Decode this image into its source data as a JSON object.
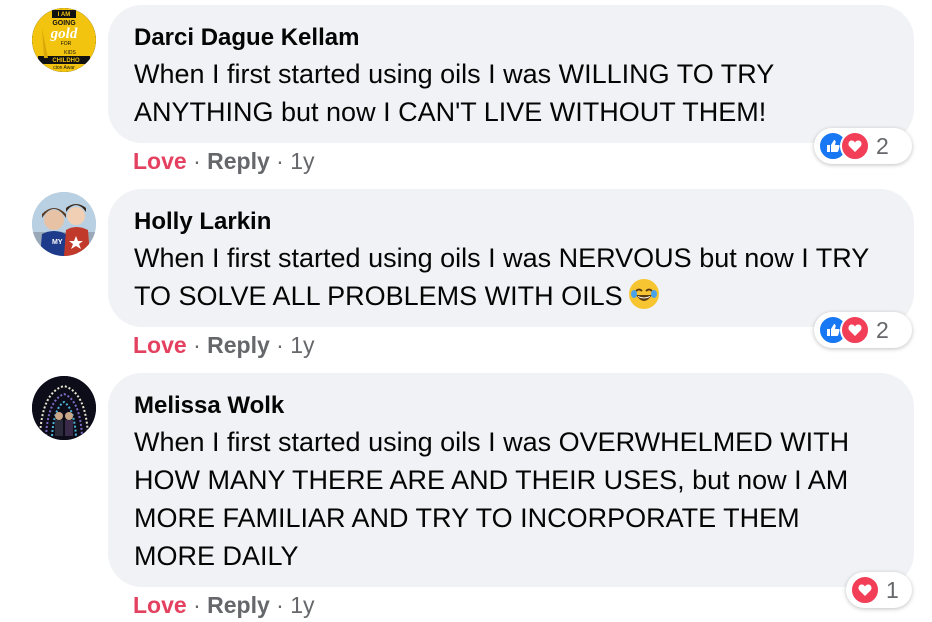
{
  "comments": [
    {
      "author": "Darci Dague Kellam",
      "text": "When I first started using oils I was WILLING TO TRY ANYTHING but now I CAN'T LIVE WITHOUT THEM!",
      "love": "Love",
      "sep1": "·",
      "reply": "Reply",
      "sep2": "·",
      "time": "1y",
      "reaction_count": "2",
      "reactions": [
        "like-icon",
        "love-icon"
      ],
      "avatar_text": [
        "I AM",
        "GOING",
        "gold",
        "FOR",
        "KIDS",
        "CHILDHO",
        "cion Awar"
      ]
    },
    {
      "author": "Holly Larkin",
      "text": "When I first started using oils I was NERVOUS but now I TRY TO SOLVE ALL PROBLEMS WITH OILS",
      "love": "Love",
      "sep1": "·",
      "reply": "Reply",
      "sep2": "·",
      "time": "1y",
      "reaction_count": "2",
      "reactions": [
        "like-icon",
        "love-icon"
      ],
      "emoji": "tears-of-joy-emoji"
    },
    {
      "author": "Melissa Wolk",
      "text": "When I first started using oils I was OVERWHELMED WITH HOW MANY THERE ARE AND THEIR USES, but now I AM MORE FAMILIAR AND TRY TO INCORPORATE THEM MORE DAILY",
      "love": "Love",
      "sep1": "·",
      "reply": "Reply",
      "sep2": "·",
      "time": "1y",
      "reaction_count": "1",
      "reactions": [
        "love-icon"
      ]
    }
  ],
  "colors": {
    "bubble": "#f0f2f5",
    "love_text": "#e4405f",
    "meta_text": "#65676b",
    "like_blue": "#1877f2",
    "heart_red": "#f33e58"
  }
}
